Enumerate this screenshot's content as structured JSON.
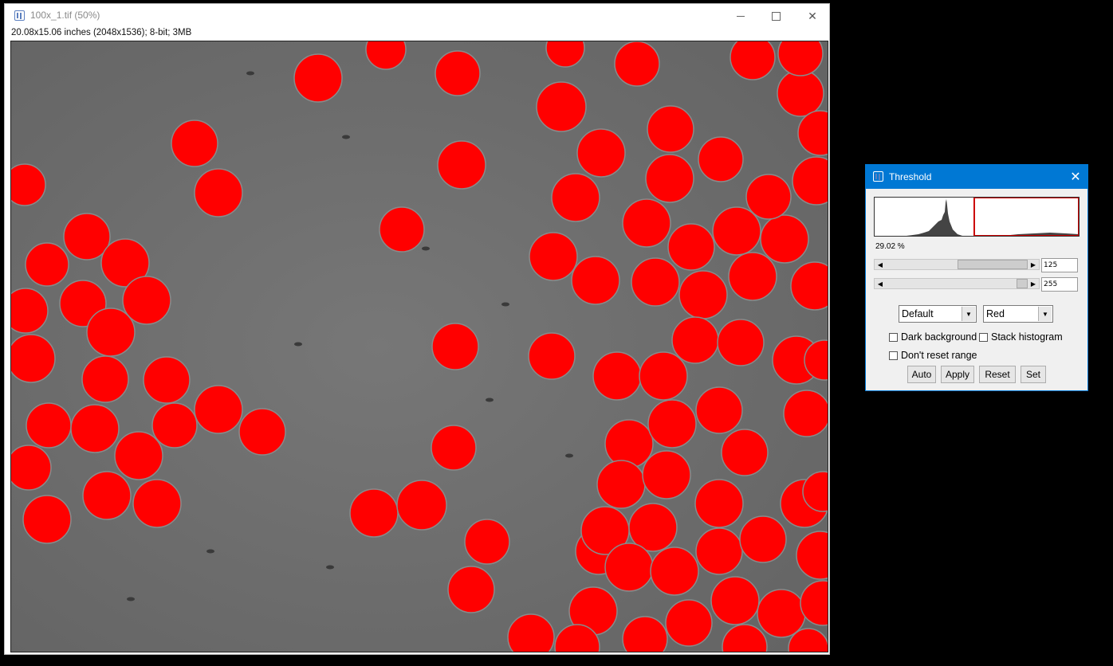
{
  "image_window": {
    "title": "100x_1.tif (50%)",
    "info": "20.08x15.06 inches (2048x1536); 8-bit; 3MB",
    "controls": {
      "minimize": "minimize",
      "maximize": "maximize",
      "close": "✕"
    },
    "canvas": {
      "background_color": "#6f6f6f",
      "overlay_color": "#ff0000",
      "overlay": "red threshold-highlighted particles on gray micrograph"
    }
  },
  "threshold": {
    "title": "Threshold",
    "close": "✕",
    "percent": "29.02 %",
    "min_value": "125",
    "max_value": "255",
    "method": "Default",
    "display": "Red",
    "dark_background_label": "Dark background",
    "stack_histogram_label": "Stack histogram",
    "dont_reset_label": "Don't reset range",
    "dark_background": false,
    "stack_histogram": false,
    "dont_reset": false,
    "buttons": {
      "auto": "Auto",
      "apply": "Apply",
      "reset": "Reset",
      "set": "Set"
    },
    "accent_color": "#0078d4",
    "threshold_line_color": "#cc0000"
  }
}
